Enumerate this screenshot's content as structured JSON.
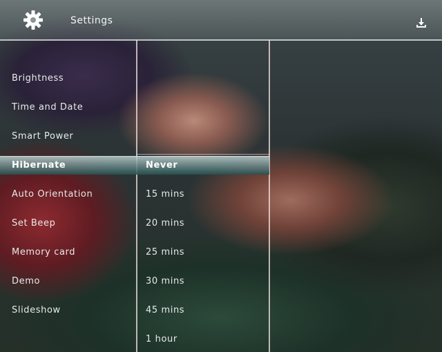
{
  "header": {
    "title": "Settings"
  },
  "icons": {
    "settings": "gear-icon",
    "download": "download-icon"
  },
  "menu": {
    "items": [
      {
        "label": "Brightness"
      },
      {
        "label": "Time and Date"
      },
      {
        "label": "Smart Power"
      },
      {
        "label": "Hibernate",
        "selected": true
      },
      {
        "label": "Auto Orientation"
      },
      {
        "label": "Set Beep"
      },
      {
        "label": "Memory card"
      },
      {
        "label": "Demo"
      },
      {
        "label": "Slideshow"
      }
    ]
  },
  "options": {
    "items": [
      {
        "label": "Never",
        "selected": true
      },
      {
        "label": "15 mins"
      },
      {
        "label": "20 mins"
      },
      {
        "label": "25 mins"
      },
      {
        "label": "30 mins"
      },
      {
        "label": "45 mins"
      },
      {
        "label": "1 hour"
      }
    ]
  }
}
